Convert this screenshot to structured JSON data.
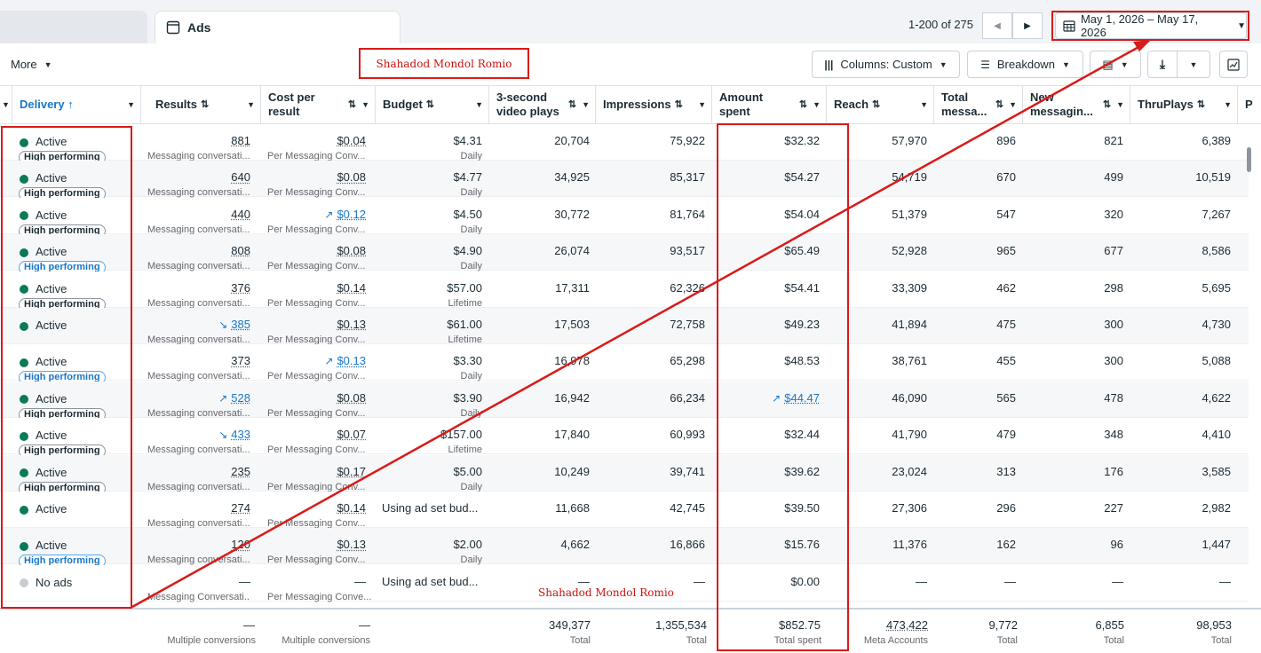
{
  "tab": {
    "label": "Ads"
  },
  "pager": {
    "text": "1-200 of 275",
    "prev": "◀",
    "next": "▶"
  },
  "date_range": "May 1, 2026 – May 17, 2026",
  "toolbar": {
    "more": "More",
    "columns": "Columns: Custom",
    "breakdown": "Breakdown"
  },
  "watermark": "Shahadod Mondol Romio",
  "headers": {
    "delivery": "Delivery ↑",
    "results": "Results",
    "cost": "Cost per result",
    "budget": "Budget",
    "video": "3-second video plays",
    "impressions": "Impressions",
    "amount": "Amount spent",
    "reach": "Reach",
    "total_msg": "Total messa...",
    "new_msg": "New messagin...",
    "thruplays": "ThruPlays",
    "next": "P"
  },
  "rows": [
    {
      "status": "Active",
      "badge": "High performing",
      "badge_style": "grey",
      "results": "881",
      "results_trend": "",
      "results_sub": "Messaging conversati...",
      "cost": "$0.04",
      "cost_trend": "",
      "cost_sub": "Per Messaging Conv...",
      "budget": "$4.31",
      "budget_sub": "Daily",
      "video": "20,704",
      "impressions": "75,922",
      "amount": "$32.32",
      "amount_trend": "",
      "reach": "57,970",
      "total_msg": "896",
      "new_msg": "821",
      "thruplays": "6,389"
    },
    {
      "status": "Active",
      "badge": "High performing",
      "badge_style": "grey",
      "results": "640",
      "results_trend": "",
      "results_sub": "Messaging conversati...",
      "cost": "$0.08",
      "cost_trend": "",
      "cost_sub": "Per Messaging Conv...",
      "budget": "$4.77",
      "budget_sub": "Daily",
      "video": "34,925",
      "impressions": "85,317",
      "amount": "$54.27",
      "amount_trend": "",
      "reach": "54,719",
      "total_msg": "670",
      "new_msg": "499",
      "thruplays": "10,519"
    },
    {
      "status": "Active",
      "badge": "High performing",
      "badge_style": "grey",
      "results": "440",
      "results_trend": "",
      "results_sub": "Messaging conversati...",
      "cost": "$0.12",
      "cost_trend": "up",
      "cost_sub": "Per Messaging Conv...",
      "budget": "$4.50",
      "budget_sub": "Daily",
      "video": "30,772",
      "impressions": "81,764",
      "amount": "$54.04",
      "amount_trend": "",
      "reach": "51,379",
      "total_msg": "547",
      "new_msg": "320",
      "thruplays": "7,267"
    },
    {
      "status": "Active",
      "badge": "High performing",
      "badge_style": "blue",
      "results": "808",
      "results_trend": "",
      "results_sub": "Messaging conversati...",
      "cost": "$0.08",
      "cost_trend": "",
      "cost_sub": "Per Messaging Conv...",
      "budget": "$4.90",
      "budget_sub": "Daily",
      "video": "26,074",
      "impressions": "93,517",
      "amount": "$65.49",
      "amount_trend": "",
      "reach": "52,928",
      "total_msg": "965",
      "new_msg": "677",
      "thruplays": "8,586"
    },
    {
      "status": "Active",
      "badge": "High performing",
      "badge_style": "grey",
      "results": "376",
      "results_trend": "",
      "results_sub": "Messaging conversati...",
      "cost": "$0.14",
      "cost_trend": "",
      "cost_sub": "Per Messaging Conv...",
      "budget": "$57.00",
      "budget_sub": "Lifetime",
      "video": "17,311",
      "impressions": "62,326",
      "amount": "$54.41",
      "amount_trend": "",
      "reach": "33,309",
      "total_msg": "462",
      "new_msg": "298",
      "thruplays": "5,695"
    },
    {
      "status": "Active",
      "badge": "",
      "badge_style": "",
      "results": "385",
      "results_trend": "down",
      "results_sub": "Messaging conversati...",
      "cost": "$0.13",
      "cost_trend": "",
      "cost_sub": "Per Messaging Conv...",
      "budget": "$61.00",
      "budget_sub": "Lifetime",
      "video": "17,503",
      "impressions": "72,758",
      "amount": "$49.23",
      "amount_trend": "",
      "reach": "41,894",
      "total_msg": "475",
      "new_msg": "300",
      "thruplays": "4,730"
    },
    {
      "status": "Active",
      "badge": "High performing",
      "badge_style": "blue",
      "results": "373",
      "results_trend": "",
      "results_sub": "Messaging conversati...",
      "cost": "$0.13",
      "cost_trend": "up",
      "cost_sub": "Per Messaging Conv...",
      "budget": "$3.30",
      "budget_sub": "Daily",
      "video": "16,978",
      "impressions": "65,298",
      "amount": "$48.53",
      "amount_trend": "",
      "reach": "38,761",
      "total_msg": "455",
      "new_msg": "300",
      "thruplays": "5,088"
    },
    {
      "status": "Active",
      "badge": "High performing",
      "badge_style": "grey",
      "results": "528",
      "results_trend": "up",
      "results_sub": "Messaging conversati...",
      "cost": "$0.08",
      "cost_trend": "",
      "cost_sub": "Per Messaging Conv...",
      "budget": "$3.90",
      "budget_sub": "Daily",
      "video": "16,942",
      "impressions": "66,234",
      "amount": "$44.47",
      "amount_trend": "up",
      "reach": "46,090",
      "total_msg": "565",
      "new_msg": "478",
      "thruplays": "4,622"
    },
    {
      "status": "Active",
      "badge": "High performing",
      "badge_style": "grey",
      "results": "433",
      "results_trend": "down",
      "results_sub": "Messaging conversati...",
      "cost": "$0.07",
      "cost_trend": "",
      "cost_sub": "Per Messaging Conv...",
      "budget": "$157.00",
      "budget_sub": "Lifetime",
      "video": "17,840",
      "impressions": "60,993",
      "amount": "$32.44",
      "amount_trend": "",
      "reach": "41,790",
      "total_msg": "479",
      "new_msg": "348",
      "thruplays": "4,410"
    },
    {
      "status": "Active",
      "badge": "High performing",
      "badge_style": "grey",
      "results": "235",
      "results_trend": "",
      "results_sub": "Messaging conversati...",
      "cost": "$0.17",
      "cost_trend": "",
      "cost_sub": "Per Messaging Conv...",
      "budget": "$5.00",
      "budget_sub": "Daily",
      "video": "10,249",
      "impressions": "39,741",
      "amount": "$39.62",
      "amount_trend": "",
      "reach": "23,024",
      "total_msg": "313",
      "new_msg": "176",
      "thruplays": "3,585"
    },
    {
      "status": "Active",
      "badge": "",
      "badge_style": "",
      "results": "274",
      "results_trend": "",
      "results_sub": "Messaging conversati...",
      "cost": "$0.14",
      "cost_trend": "",
      "cost_sub": "Per Messaging Conv...",
      "budget": "Using ad set bud...",
      "budget_sub": "",
      "video": "11,668",
      "impressions": "42,745",
      "amount": "$39.50",
      "amount_trend": "",
      "reach": "27,306",
      "total_msg": "296",
      "new_msg": "227",
      "thruplays": "2,982"
    },
    {
      "status": "Active",
      "badge": "High performing",
      "badge_style": "blue",
      "results": "120",
      "results_trend": "",
      "results_sub": "Messaging conversati...",
      "cost": "$0.13",
      "cost_trend": "",
      "cost_sub": "Per Messaging Conv...",
      "budget": "$2.00",
      "budget_sub": "Daily",
      "video": "4,662",
      "impressions": "16,866",
      "amount": "$15.76",
      "amount_trend": "",
      "reach": "11,376",
      "total_msg": "162",
      "new_msg": "96",
      "thruplays": "1,447"
    },
    {
      "status": "No ads",
      "badge": "",
      "badge_style": "",
      "results": "—",
      "results_trend": "",
      "results_sub": "Messaging Conversati...",
      "cost": "—",
      "cost_trend": "",
      "cost_sub": "Per Messaging Conve...",
      "budget": "Using ad set bud...",
      "budget_sub": "",
      "video": "—",
      "impressions": "—",
      "amount": "$0.00",
      "amount_trend": "",
      "reach": "—",
      "total_msg": "—",
      "new_msg": "—",
      "thruplays": "—"
    }
  ],
  "totals": {
    "results": "—",
    "results_sub": "Multiple conversions",
    "cost": "—",
    "cost_sub": "Multiple conversions",
    "video": "349,377",
    "video_sub": "Total",
    "impressions": "1,355,534",
    "impressions_sub": "Total",
    "amount": "$852.75",
    "amount_sub": "Total spent",
    "reach": "473,422",
    "reach_sub": "Meta Accounts",
    "total_msg": "9,772",
    "total_msg_sub": "Total",
    "new_msg": "6,855",
    "new_msg_sub": "Total",
    "thruplays": "98,953",
    "thruplays_sub": "Total"
  },
  "colors": {
    "accent": "#1877c9",
    "active": "#0b7a57",
    "annotation": "#d91a1a"
  }
}
